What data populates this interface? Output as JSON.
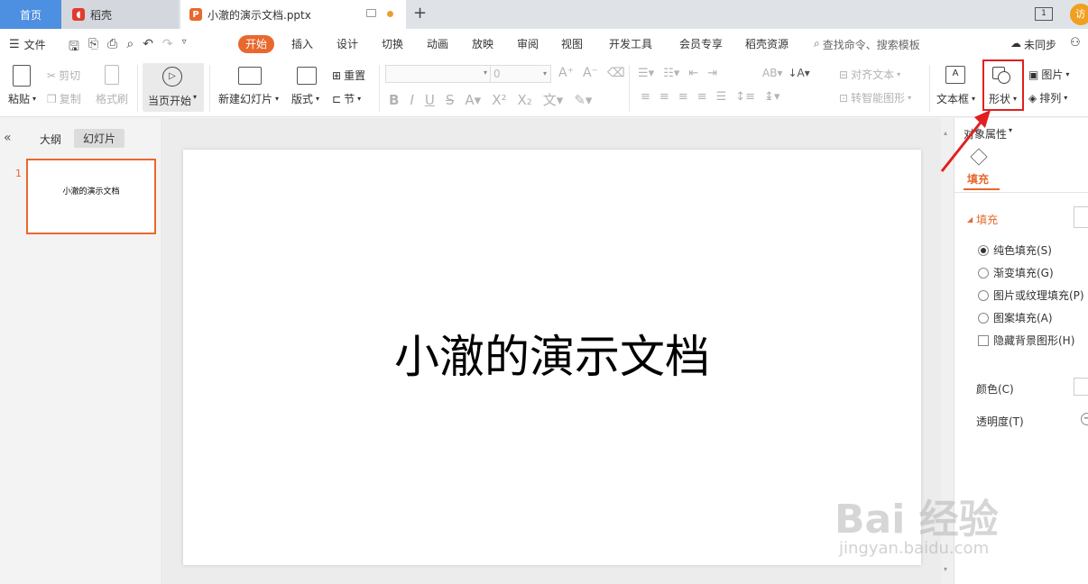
{
  "tabs": {
    "home": "首页",
    "daoke": "稻壳",
    "doc": "小澈的演示文档.pptx",
    "new_tab": "+",
    "user_badge": "访"
  },
  "menu": {
    "file": "文件",
    "items": [
      "开始",
      "插入",
      "设计",
      "切换",
      "动画",
      "放映",
      "审阅",
      "视图",
      "开发工具",
      "会员专享",
      "稻壳资源"
    ],
    "active": "开始",
    "search_placeholder": "查找命令、搜索模板",
    "sync": "未同步"
  },
  "ribbon": {
    "paste": "粘贴",
    "cut": "剪切",
    "copy": "复制",
    "format_painter": "格式刷",
    "from_current": "当页开始",
    "new_slide": "新建幻灯片",
    "layout": "版式",
    "reset": "重置",
    "section": "节",
    "font_size": "0",
    "align_text": "对齐文本",
    "smart_shape": "转智能图形",
    "textbox": "文本框",
    "shape": "形状",
    "picture": "图片",
    "arrange": "排列"
  },
  "left_pane": {
    "outline_tab": "大纲",
    "slides_tab": "幻灯片",
    "slide_number": "1",
    "thumb_title": "小澈的演示文档"
  },
  "slide": {
    "title": "小澈的演示文档"
  },
  "right_pane": {
    "header": "对象属性",
    "tab_fill": "填充",
    "section_fill": "填充",
    "options": [
      "纯色填充(S)",
      "渐变填充(G)",
      "图片或纹理填充(P)",
      "图案填充(A)"
    ],
    "hide_bg": "隐藏背景图形(H)",
    "color_label": "颜色(C)",
    "transparency_label": "透明度(T)"
  },
  "watermark": {
    "brand": "Bai  经验",
    "url": "jingyan.baidu.com"
  },
  "colors": {
    "accent": "#e8682e",
    "home_tab": "#4d8fe0",
    "highlight_box": "#e02020"
  }
}
